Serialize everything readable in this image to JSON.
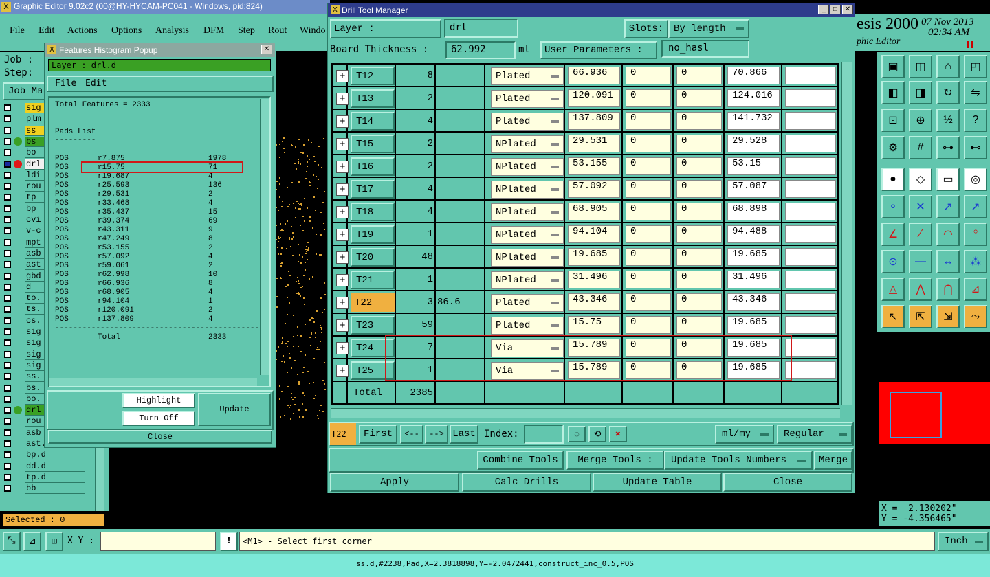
{
  "app": {
    "title": "Graphic Editor 9.02c2 (00@HY-HYCAM-PC041 - Windows, pid:824)"
  },
  "menu": [
    "File",
    "Edit",
    "Actions",
    "Options",
    "Analysis",
    "DFM",
    "Step",
    "Rout",
    "Windo"
  ],
  "brand": {
    "name": "esis 2000",
    "date": "07 Nov 2013",
    "time": "02:34 AM",
    "sub": "phic Editor"
  },
  "job": {
    "job_label": "Job :",
    "step_label": "Step:",
    "job_manager": "Job Ma"
  },
  "layers": [
    {
      "name": "sig",
      "checked": false,
      "hl": "yellow"
    },
    {
      "name": "plm",
      "checked": false
    },
    {
      "name": "ss",
      "checked": false,
      "hl": "yellow"
    },
    {
      "name": "bs",
      "checked": false,
      "hl": "green"
    },
    {
      "name": "bo",
      "checked": false
    },
    {
      "name": "drl",
      "checked": true,
      "hl": "red"
    },
    {
      "name": "ldi",
      "checked": false
    },
    {
      "name": "rou",
      "checked": false
    },
    {
      "name": "tp",
      "checked": false
    },
    {
      "name": "bp",
      "checked": false
    },
    {
      "name": "cvi",
      "checked": false
    },
    {
      "name": "v-c",
      "checked": false
    },
    {
      "name": "mpt",
      "checked": false
    },
    {
      "name": "asb",
      "checked": false
    },
    {
      "name": "ast",
      "checked": false
    },
    {
      "name": "gbd",
      "checked": false
    },
    {
      "name": "d",
      "checked": false
    },
    {
      "name": "to.",
      "checked": false
    },
    {
      "name": "ts.",
      "checked": false
    },
    {
      "name": "cs.",
      "checked": false
    },
    {
      "name": "sig",
      "checked": false
    },
    {
      "name": "sig",
      "checked": false
    },
    {
      "name": "sig",
      "checked": false
    },
    {
      "name": "sig",
      "checked": false
    },
    {
      "name": "ss.",
      "checked": false
    },
    {
      "name": "bs.",
      "checked": false
    },
    {
      "name": "bo.",
      "checked": false
    },
    {
      "name": "drl",
      "checked": false,
      "hl": "green"
    },
    {
      "name": "rou",
      "checked": false
    },
    {
      "name": "asb",
      "checked": false
    },
    {
      "name": "ast.d",
      "checked": false
    },
    {
      "name": "bp.d",
      "checked": false
    },
    {
      "name": "dd.d",
      "checked": false
    },
    {
      "name": "tp.d",
      "checked": false
    },
    {
      "name": "bb",
      "checked": false
    }
  ],
  "selected": "Selected : 0",
  "histogram": {
    "title": "Features Histogram Popup",
    "layer": "Layer :  drl.d",
    "menu": [
      "File",
      "Edit"
    ],
    "total_features": "Total Features = 2333",
    "pads_title": "Pads List",
    "pads_underline": "---------",
    "rows": [
      [
        "POS",
        "r7.875",
        "1978"
      ],
      [
        "POS",
        "r15.75",
        "71"
      ],
      [
        "POS",
        "r19.687",
        "4"
      ],
      [
        "POS",
        "r25.593",
        "136"
      ],
      [
        "POS",
        "r29.531",
        "2"
      ],
      [
        "POS",
        "r33.468",
        "4"
      ],
      [
        "POS",
        "r35.437",
        "15"
      ],
      [
        "POS",
        "r39.374",
        "69"
      ],
      [
        "POS",
        "r43.311",
        "9"
      ],
      [
        "POS",
        "r47.249",
        "8"
      ],
      [
        "POS",
        "r53.155",
        "2"
      ],
      [
        "POS",
        "r57.092",
        "4"
      ],
      [
        "POS",
        "r59.061",
        "2"
      ],
      [
        "POS",
        "r62.998",
        "10"
      ],
      [
        "POS",
        "r66.936",
        "8"
      ],
      [
        "POS",
        "r68.905",
        "4"
      ],
      [
        "POS",
        "r94.104",
        "1"
      ],
      [
        "POS",
        "r120.091",
        "2"
      ],
      [
        "POS",
        "r137.809",
        "4"
      ]
    ],
    "separator": "----------------------------------------------",
    "total_label": "Total",
    "total_value": "2333",
    "highlight": "Highlight",
    "turn_off": "Turn Off",
    "update": "Update",
    "close": "Close"
  },
  "drill": {
    "title": "Drill Tool Manager",
    "layer_label": "Layer          :",
    "layer_value": "drl",
    "slots_label": "Slots:",
    "slots_value": "By length",
    "thickness_label": "Board Thickness :",
    "thickness_value": "62.992",
    "thickness_unit": "ml",
    "user_params_label": "User Parameters :",
    "user_params_value": "no_hasl",
    "rows": [
      {
        "tool": "T12",
        "count": "8",
        "extra": "",
        "type": "Plated",
        "a": "66.936",
        "b": "0",
        "c": "0",
        "d": "70.866",
        "e": ""
      },
      {
        "tool": "T13",
        "count": "2",
        "extra": "",
        "type": "Plated",
        "a": "120.091",
        "b": "0",
        "c": "0",
        "d": "124.016",
        "e": ""
      },
      {
        "tool": "T14",
        "count": "4",
        "extra": "",
        "type": "Plated",
        "a": "137.809",
        "b": "0",
        "c": "0",
        "d": "141.732",
        "e": ""
      },
      {
        "tool": "T15",
        "count": "2",
        "extra": "",
        "type": "NPlated",
        "a": "29.531",
        "b": "0",
        "c": "0",
        "d": "29.528",
        "e": ""
      },
      {
        "tool": "T16",
        "count": "2",
        "extra": "",
        "type": "NPlated",
        "a": "53.155",
        "b": "0",
        "c": "0",
        "d": "53.15",
        "e": ""
      },
      {
        "tool": "T17",
        "count": "4",
        "extra": "",
        "type": "NPlated",
        "a": "57.092",
        "b": "0",
        "c": "0",
        "d": "57.087",
        "e": ""
      },
      {
        "tool": "T18",
        "count": "4",
        "extra": "",
        "type": "NPlated",
        "a": "68.905",
        "b": "0",
        "c": "0",
        "d": "68.898",
        "e": ""
      },
      {
        "tool": "T19",
        "count": "1",
        "extra": "",
        "type": "NPlated",
        "a": "94.104",
        "b": "0",
        "c": "0",
        "d": "94.488",
        "e": ""
      },
      {
        "tool": "T20",
        "count": "48",
        "extra": "",
        "type": "NPlated",
        "a": "19.685",
        "b": "0",
        "c": "0",
        "d": "19.685",
        "e": ""
      },
      {
        "tool": "T21",
        "count": "1",
        "extra": "",
        "type": "NPlated",
        "a": "31.496",
        "b": "0",
        "c": "0",
        "d": "31.496",
        "e": ""
      },
      {
        "tool": "T22",
        "count": "3",
        "extra": "86.6",
        "type": "Plated",
        "a": "43.346",
        "b": "0",
        "c": "0",
        "d": "43.346",
        "e": "",
        "active": true
      },
      {
        "tool": "T23",
        "count": "59",
        "extra": "",
        "type": "Plated",
        "a": "15.75",
        "b": "0",
        "c": "0",
        "d": "19.685",
        "e": ""
      },
      {
        "tool": "T24",
        "count": "7",
        "extra": "",
        "type": "Via",
        "a": "15.789",
        "b": "0",
        "c": "0",
        "d": "19.685",
        "e": ""
      },
      {
        "tool": "T25",
        "count": "1",
        "extra": "",
        "type": "Via",
        "a": "15.789",
        "b": "0",
        "c": "0",
        "d": "19.685",
        "e": ""
      }
    ],
    "total_label": "Total",
    "total_value": "2385",
    "nav": {
      "current": "T22",
      "first": "First",
      "prev": "<--",
      "next": "-->",
      "last": "Last",
      "index_label": "Index:",
      "units": "ml/my",
      "mode": "Regular"
    },
    "actions": {
      "combine": "Combine Tools",
      "merge_label": "Merge Tools :",
      "update_numbers": "Update Tools Numbers",
      "merge": "Merge"
    },
    "bottom": {
      "apply": "Apply",
      "calc": "Calc Drills",
      "update_table": "Update Table",
      "close": "Close"
    }
  },
  "coords": {
    "x": "X =  2.130202\"",
    "y": "Y = -4.356465\""
  },
  "status": {
    "xy_label": "X Y :",
    "prompt": "<M1> - Select first corner",
    "units": "Inch",
    "footer": "ss.d,#2238,Pad,X=2.3818898,Y=-2.0472441,construct_inc_0.5,POS"
  },
  "colors": {
    "teal": "#62c6ae",
    "highlight_box": "#d01818",
    "brand_red": "#cc0000"
  }
}
